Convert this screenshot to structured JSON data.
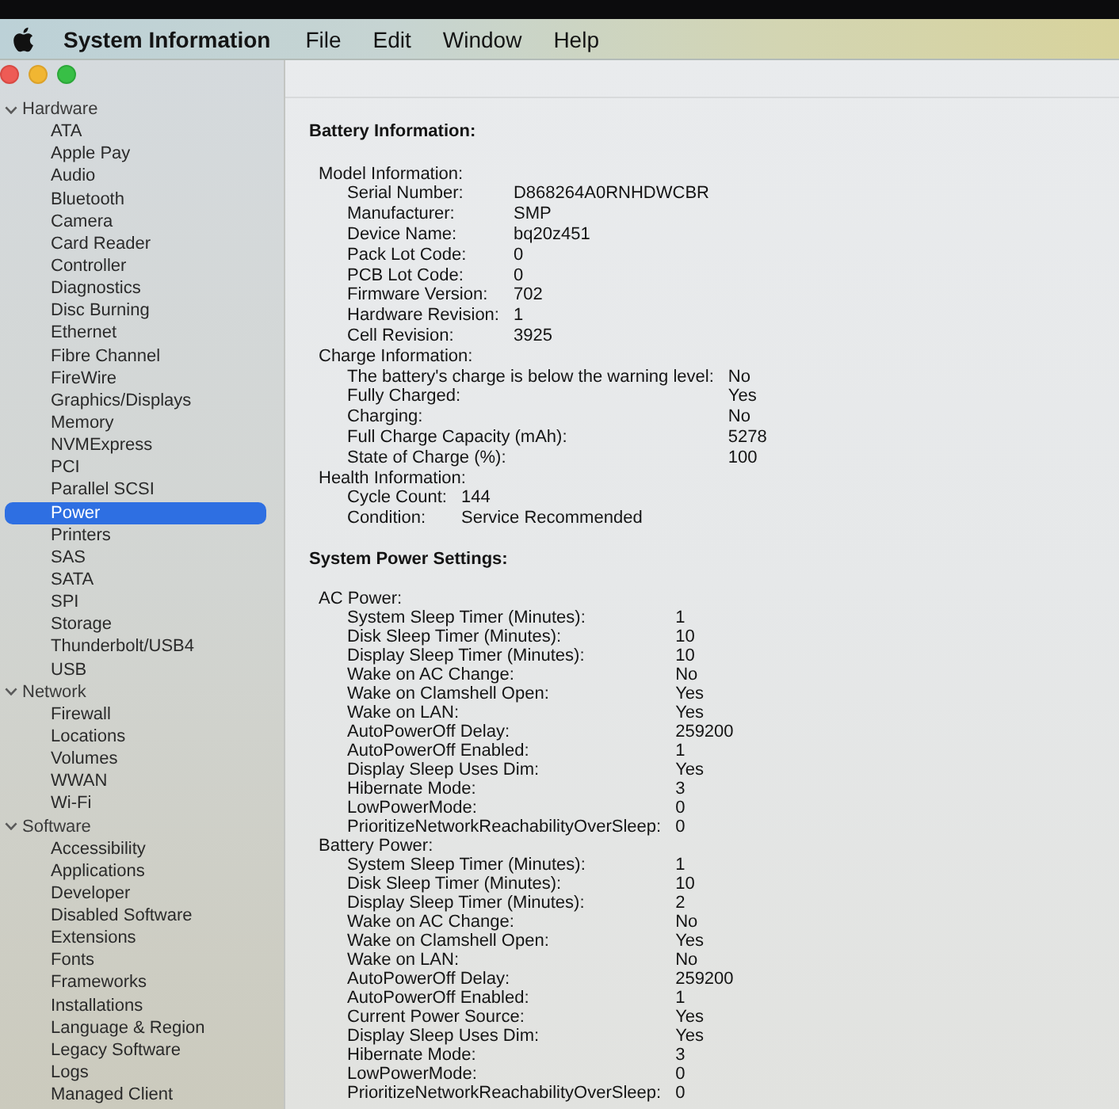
{
  "menu_bar": {
    "app_name": "System Information",
    "items": [
      "File",
      "Edit",
      "Window",
      "Help"
    ]
  },
  "sidebar": {
    "items": [
      {
        "label": "Hardware",
        "expanded": true,
        "selected": false,
        "children": [
          {
            "label": "ATA",
            "selected": false
          },
          {
            "label": "Apple Pay",
            "selected": false
          },
          {
            "label": "Audio",
            "selected": false
          },
          {
            "label": "Bluetooth",
            "selected": false
          },
          {
            "label": "Camera",
            "selected": false
          },
          {
            "label": "Card Reader",
            "selected": false
          },
          {
            "label": "Controller",
            "selected": false
          },
          {
            "label": "Diagnostics",
            "selected": false
          },
          {
            "label": "Disc Burning",
            "selected": false
          },
          {
            "label": "Ethernet",
            "selected": false
          },
          {
            "label": "Fibre Channel",
            "selected": false
          },
          {
            "label": "FireWire",
            "selected": false
          },
          {
            "label": "Graphics/Displays",
            "selected": false
          },
          {
            "label": "Memory",
            "selected": false
          },
          {
            "label": "NVMExpress",
            "selected": false
          },
          {
            "label": "PCI",
            "selected": false
          },
          {
            "label": "Parallel SCSI",
            "selected": false
          },
          {
            "label": "Power",
            "selected": true
          },
          {
            "label": "Printers",
            "selected": false
          },
          {
            "label": "SAS",
            "selected": false
          },
          {
            "label": "SATA",
            "selected": false
          },
          {
            "label": "SPI",
            "selected": false
          },
          {
            "label": "Storage",
            "selected": false
          },
          {
            "label": "Thunderbolt/USB4",
            "selected": false
          },
          {
            "label": "USB",
            "selected": false
          }
        ]
      },
      {
        "label": "Network",
        "expanded": true,
        "selected": false,
        "children": [
          {
            "label": "Firewall",
            "selected": false
          },
          {
            "label": "Locations",
            "selected": false
          },
          {
            "label": "Volumes",
            "selected": false
          },
          {
            "label": "WWAN",
            "selected": false
          },
          {
            "label": "Wi-Fi",
            "selected": false
          }
        ]
      },
      {
        "label": "Software",
        "expanded": true,
        "selected": false,
        "children": [
          {
            "label": "Accessibility",
            "selected": false
          },
          {
            "label": "Applications",
            "selected": false
          },
          {
            "label": "Developer",
            "selected": false
          },
          {
            "label": "Disabled Software",
            "selected": false
          },
          {
            "label": "Extensions",
            "selected": false
          },
          {
            "label": "Fonts",
            "selected": false
          },
          {
            "label": "Frameworks",
            "selected": false
          },
          {
            "label": "Installations",
            "selected": false
          },
          {
            "label": "Language & Region",
            "selected": false
          },
          {
            "label": "Legacy Software",
            "selected": false
          },
          {
            "label": "Logs",
            "selected": false
          },
          {
            "label": "Managed Client",
            "selected": false
          }
        ]
      }
    ]
  },
  "report": {
    "sections": [
      {
        "title": "Battery Information:",
        "groups": [
          {
            "label": "Model Information:",
            "rows": [
              {
                "label": "Serial Number:",
                "value": "D868264A0RNHDWCBR"
              },
              {
                "label": "Manufacturer:",
                "value": "SMP"
              },
              {
                "label": "Device Name:",
                "value": "bq20z451"
              },
              {
                "label": "Pack Lot Code:",
                "value": "0"
              },
              {
                "label": "PCB Lot Code:",
                "value": "0"
              },
              {
                "label": "Firmware Version:",
                "value": "702"
              },
              {
                "label": "Hardware Revision:",
                "value": "1"
              },
              {
                "label": "Cell Revision:",
                "value": "3925"
              }
            ]
          },
          {
            "label": "Charge Information:",
            "rows": [
              {
                "label": "The battery's charge is below the warning level:",
                "value": "No"
              },
              {
                "label": "Fully Charged:",
                "value": "Yes"
              },
              {
                "label": "Charging:",
                "value": "No"
              },
              {
                "label": "Full Charge Capacity (mAh):",
                "value": "5278"
              },
              {
                "label": "State of Charge (%):",
                "value": "100"
              }
            ]
          },
          {
            "label": "Health Information:",
            "rows": [
              {
                "label": "Cycle Count:",
                "value": "144"
              },
              {
                "label": "Condition:",
                "value": "Service Recommended"
              }
            ]
          }
        ]
      },
      {
        "title": "System Power Settings:",
        "groups": [
          {
            "label": "AC Power:",
            "rows": [
              {
                "label": "System Sleep Timer (Minutes):",
                "value": "1"
              },
              {
                "label": "Disk Sleep Timer (Minutes):",
                "value": "10"
              },
              {
                "label": "Display Sleep Timer (Minutes):",
                "value": "10"
              },
              {
                "label": "Wake on AC Change:",
                "value": "No"
              },
              {
                "label": "Wake on Clamshell Open:",
                "value": "Yes"
              },
              {
                "label": "Wake on LAN:",
                "value": "Yes"
              },
              {
                "label": "AutoPowerOff Delay:",
                "value": "259200"
              },
              {
                "label": "AutoPowerOff Enabled:",
                "value": "1"
              },
              {
                "label": "Display Sleep Uses Dim:",
                "value": "Yes"
              },
              {
                "label": "Hibernate Mode:",
                "value": "3"
              },
              {
                "label": "LowPowerMode:",
                "value": "0"
              },
              {
                "label": "PrioritizeNetworkReachabilityOverSleep:",
                "value": "0"
              }
            ]
          },
          {
            "label": "Battery Power:",
            "rows": [
              {
                "label": "System Sleep Timer (Minutes):",
                "value": "1"
              },
              {
                "label": "Disk Sleep Timer (Minutes):",
                "value": "10"
              },
              {
                "label": "Display Sleep Timer (Minutes):",
                "value": "2"
              },
              {
                "label": "Wake on AC Change:",
                "value": "No"
              },
              {
                "label": "Wake on Clamshell Open:",
                "value": "Yes"
              },
              {
                "label": "Wake on LAN:",
                "value": "No"
              },
              {
                "label": "AutoPowerOff Delay:",
                "value": "259200"
              },
              {
                "label": "AutoPowerOff Enabled:",
                "value": "1"
              },
              {
                "label": "Current Power Source:",
                "value": "Yes"
              },
              {
                "label": "Display Sleep Uses Dim:",
                "value": "Yes"
              },
              {
                "label": "Hibernate Mode:",
                "value": "3"
              },
              {
                "label": "LowPowerMode:",
                "value": "0"
              },
              {
                "label": "PrioritizeNetworkReachabilityOverSleep:",
                "value": "0"
              }
            ]
          }
        ]
      }
    ]
  }
}
